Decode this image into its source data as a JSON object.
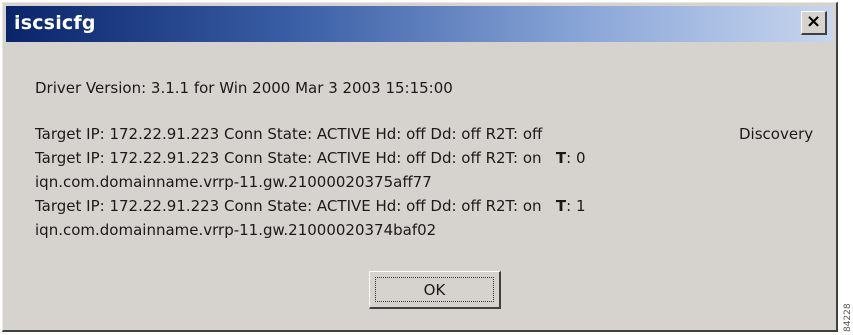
{
  "window": {
    "title": "iscsicfg",
    "close_glyph": "×"
  },
  "driver_line": "Driver Version: 3.1.1  for Win 2000    Mar  3 2003  15:15:00",
  "targets": [
    {
      "line1": "Target IP: 172.22.91.223    Conn State: ACTIVE Hd: off  Dd: off  R2T: off",
      "suffix": "Discovery"
    },
    {
      "line1": "Target IP: 172.22.91.223    Conn State: ACTIVE Hd: off  Dd: off  R2T: on",
      "t_label": "T",
      "t_value": ": 0",
      "iqn": "iqn.com.domainname.vrrp-11.gw.21000020375aff77"
    },
    {
      "line1": "Target IP: 172.22.91.223    Conn State: ACTIVE Hd: off  Dd: off  R2T: on",
      "t_label": "T",
      "t_value": ": 1",
      "iqn": "iqn.com.domainname.vrrp-11.gw.21000020374baf02"
    }
  ],
  "buttons": {
    "ok_label": "OK"
  },
  "figure_code": "84228"
}
